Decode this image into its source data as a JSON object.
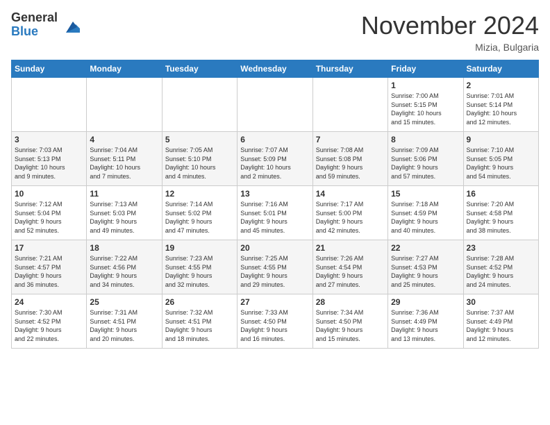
{
  "header": {
    "logo_line1": "General",
    "logo_line2": "Blue",
    "month": "November 2024",
    "location": "Mizia, Bulgaria"
  },
  "weekdays": [
    "Sunday",
    "Monday",
    "Tuesday",
    "Wednesday",
    "Thursday",
    "Friday",
    "Saturday"
  ],
  "weeks": [
    [
      {
        "day": "",
        "info": ""
      },
      {
        "day": "",
        "info": ""
      },
      {
        "day": "",
        "info": ""
      },
      {
        "day": "",
        "info": ""
      },
      {
        "day": "",
        "info": ""
      },
      {
        "day": "1",
        "info": "Sunrise: 7:00 AM\nSunset: 5:15 PM\nDaylight: 10 hours\nand 15 minutes."
      },
      {
        "day": "2",
        "info": "Sunrise: 7:01 AM\nSunset: 5:14 PM\nDaylight: 10 hours\nand 12 minutes."
      }
    ],
    [
      {
        "day": "3",
        "info": "Sunrise: 7:03 AM\nSunset: 5:13 PM\nDaylight: 10 hours\nand 9 minutes."
      },
      {
        "day": "4",
        "info": "Sunrise: 7:04 AM\nSunset: 5:11 PM\nDaylight: 10 hours\nand 7 minutes."
      },
      {
        "day": "5",
        "info": "Sunrise: 7:05 AM\nSunset: 5:10 PM\nDaylight: 10 hours\nand 4 minutes."
      },
      {
        "day": "6",
        "info": "Sunrise: 7:07 AM\nSunset: 5:09 PM\nDaylight: 10 hours\nand 2 minutes."
      },
      {
        "day": "7",
        "info": "Sunrise: 7:08 AM\nSunset: 5:08 PM\nDaylight: 9 hours\nand 59 minutes."
      },
      {
        "day": "8",
        "info": "Sunrise: 7:09 AM\nSunset: 5:06 PM\nDaylight: 9 hours\nand 57 minutes."
      },
      {
        "day": "9",
        "info": "Sunrise: 7:10 AM\nSunset: 5:05 PM\nDaylight: 9 hours\nand 54 minutes."
      }
    ],
    [
      {
        "day": "10",
        "info": "Sunrise: 7:12 AM\nSunset: 5:04 PM\nDaylight: 9 hours\nand 52 minutes."
      },
      {
        "day": "11",
        "info": "Sunrise: 7:13 AM\nSunset: 5:03 PM\nDaylight: 9 hours\nand 49 minutes."
      },
      {
        "day": "12",
        "info": "Sunrise: 7:14 AM\nSunset: 5:02 PM\nDaylight: 9 hours\nand 47 minutes."
      },
      {
        "day": "13",
        "info": "Sunrise: 7:16 AM\nSunset: 5:01 PM\nDaylight: 9 hours\nand 45 minutes."
      },
      {
        "day": "14",
        "info": "Sunrise: 7:17 AM\nSunset: 5:00 PM\nDaylight: 9 hours\nand 42 minutes."
      },
      {
        "day": "15",
        "info": "Sunrise: 7:18 AM\nSunset: 4:59 PM\nDaylight: 9 hours\nand 40 minutes."
      },
      {
        "day": "16",
        "info": "Sunrise: 7:20 AM\nSunset: 4:58 PM\nDaylight: 9 hours\nand 38 minutes."
      }
    ],
    [
      {
        "day": "17",
        "info": "Sunrise: 7:21 AM\nSunset: 4:57 PM\nDaylight: 9 hours\nand 36 minutes."
      },
      {
        "day": "18",
        "info": "Sunrise: 7:22 AM\nSunset: 4:56 PM\nDaylight: 9 hours\nand 34 minutes."
      },
      {
        "day": "19",
        "info": "Sunrise: 7:23 AM\nSunset: 4:55 PM\nDaylight: 9 hours\nand 32 minutes."
      },
      {
        "day": "20",
        "info": "Sunrise: 7:25 AM\nSunset: 4:55 PM\nDaylight: 9 hours\nand 29 minutes."
      },
      {
        "day": "21",
        "info": "Sunrise: 7:26 AM\nSunset: 4:54 PM\nDaylight: 9 hours\nand 27 minutes."
      },
      {
        "day": "22",
        "info": "Sunrise: 7:27 AM\nSunset: 4:53 PM\nDaylight: 9 hours\nand 25 minutes."
      },
      {
        "day": "23",
        "info": "Sunrise: 7:28 AM\nSunset: 4:52 PM\nDaylight: 9 hours\nand 24 minutes."
      }
    ],
    [
      {
        "day": "24",
        "info": "Sunrise: 7:30 AM\nSunset: 4:52 PM\nDaylight: 9 hours\nand 22 minutes."
      },
      {
        "day": "25",
        "info": "Sunrise: 7:31 AM\nSunset: 4:51 PM\nDaylight: 9 hours\nand 20 minutes."
      },
      {
        "day": "26",
        "info": "Sunrise: 7:32 AM\nSunset: 4:51 PM\nDaylight: 9 hours\nand 18 minutes."
      },
      {
        "day": "27",
        "info": "Sunrise: 7:33 AM\nSunset: 4:50 PM\nDaylight: 9 hours\nand 16 minutes."
      },
      {
        "day": "28",
        "info": "Sunrise: 7:34 AM\nSunset: 4:50 PM\nDaylight: 9 hours\nand 15 minutes."
      },
      {
        "day": "29",
        "info": "Sunrise: 7:36 AM\nSunset: 4:49 PM\nDaylight: 9 hours\nand 13 minutes."
      },
      {
        "day": "30",
        "info": "Sunrise: 7:37 AM\nSunset: 4:49 PM\nDaylight: 9 hours\nand 12 minutes."
      }
    ]
  ]
}
